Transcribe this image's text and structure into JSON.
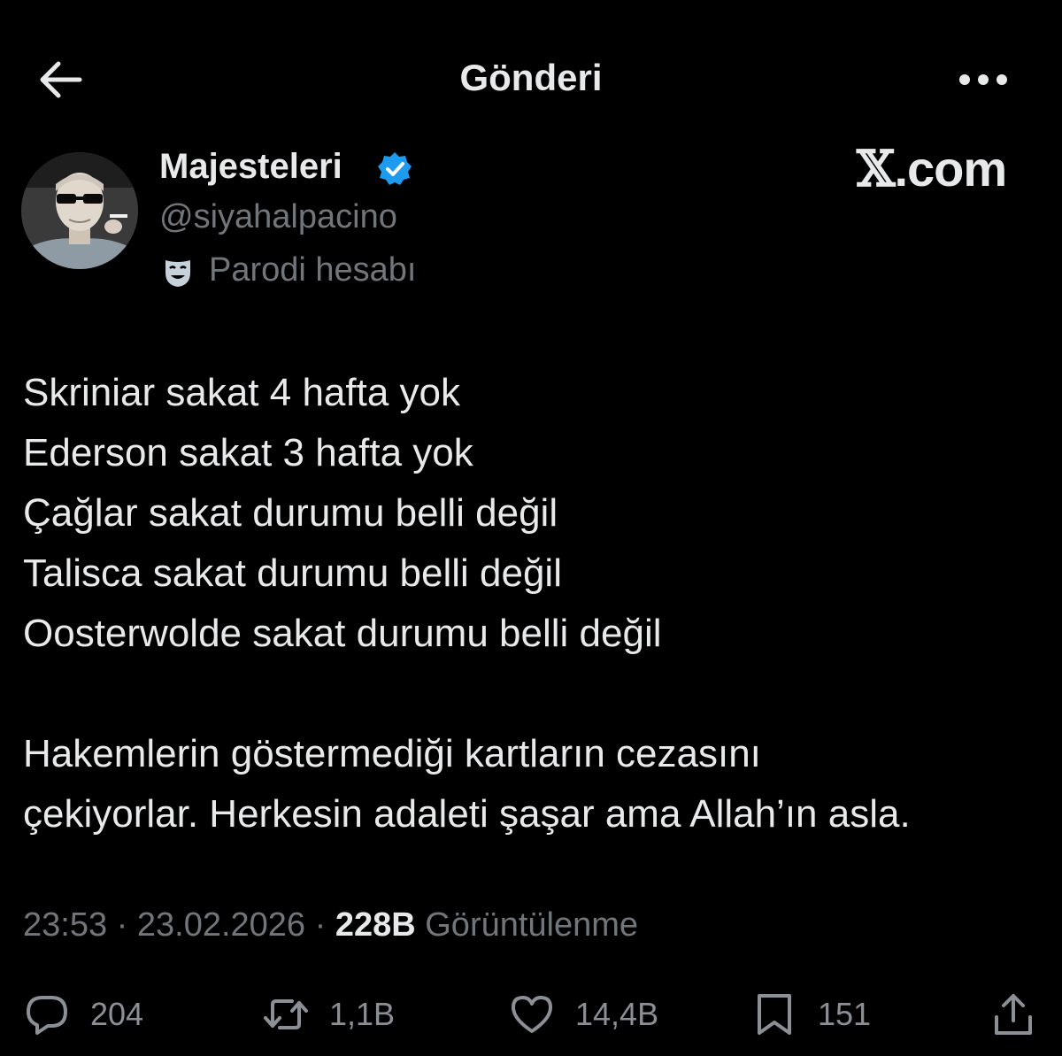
{
  "header": {
    "title": "Gönderi"
  },
  "author": {
    "display_name": "Majesteleri",
    "handle": "@siyahalpacino",
    "parody_label": "Parodi hesabı",
    "verified": true,
    "verified_color": "#1d9bf0"
  },
  "watermark": {
    "x_glyph": "𝕏",
    "domain": ".com"
  },
  "tweet": {
    "lines": [
      "Skriniar sakat 4 hafta yok",
      "Ederson sakat 3 hafta yok",
      "Çağlar sakat durumu belli değil",
      "Talisca sakat durumu belli değil",
      "Oosterwolde sakat durumu belli değil"
    ],
    "closing_lines": [
      "Hakemlerin göstermediği kartların cezasını",
      "çekiyorlar. Herkesin adaleti şaşar ama Allah’ın asla."
    ]
  },
  "meta": {
    "time": "23:53",
    "separator": "·",
    "date": "23.02.2026",
    "views_count": "228B",
    "views_label": "Görüntülenme"
  },
  "actions": {
    "replies": "204",
    "reposts": "1,1B",
    "likes": "14,4B",
    "bookmarks": "151"
  },
  "colors": {
    "background": "#000000",
    "primary_text": "#e7e9ea",
    "secondary_text": "#71767b",
    "accent": "#1d9bf0"
  },
  "icons": {
    "back": "arrow-left-icon",
    "more": "more-horizontal-icon",
    "verified": "verified-badge-icon",
    "parody": "theater-mask-icon",
    "reply": "reply-icon",
    "repost": "repost-icon",
    "like": "heart-icon",
    "bookmark": "bookmark-icon",
    "share": "share-icon"
  }
}
